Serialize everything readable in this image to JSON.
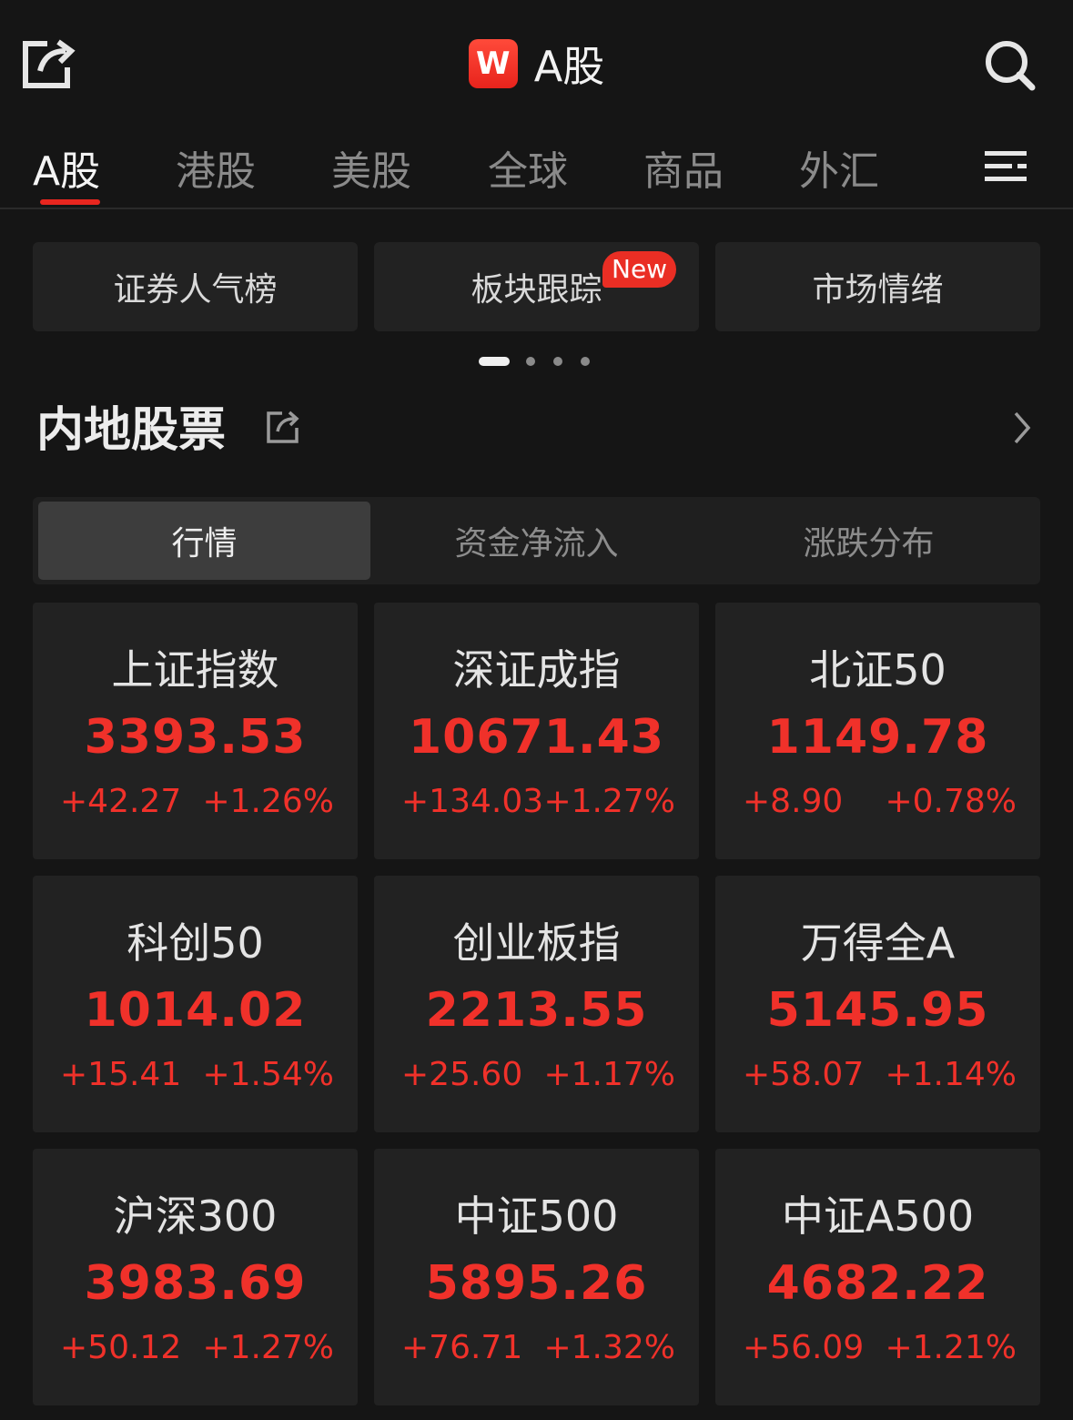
{
  "header": {
    "logo_letter": "W",
    "title": "A股",
    "icons": {
      "left": "share-icon",
      "right": "search-icon"
    }
  },
  "tabs": [
    {
      "label": "A股",
      "active": true
    },
    {
      "label": "港股"
    },
    {
      "label": "美股"
    },
    {
      "label": "全球"
    },
    {
      "label": "商品"
    },
    {
      "label": "外汇"
    }
  ],
  "quick_links": [
    {
      "label": "证券人气榜"
    },
    {
      "label": "板块跟踪",
      "badge": "New"
    },
    {
      "label": "市场情绪"
    }
  ],
  "section": {
    "title": "内地股票"
  },
  "segments": [
    {
      "label": "行情",
      "active": true
    },
    {
      "label": "资金净流入"
    },
    {
      "label": "涨跌分布"
    }
  ],
  "colors": {
    "up": "#f0312a",
    "accent": "#e8261f",
    "background": "#151515",
    "card": "#222222"
  },
  "indices": [
    {
      "name": "上证指数",
      "value": "3393.53",
      "change": "+42.27",
      "pct": "+1.26%"
    },
    {
      "name": "深证成指",
      "value": "10671.43",
      "change": "+134.03",
      "pct": "+1.27%"
    },
    {
      "name": "北证50",
      "value": "1149.78",
      "change": "+8.90",
      "pct": "+0.78%"
    },
    {
      "name": "科创50",
      "value": "1014.02",
      "change": "+15.41",
      "pct": "+1.54%"
    },
    {
      "name": "创业板指",
      "value": "2213.55",
      "change": "+25.60",
      "pct": "+1.17%"
    },
    {
      "name": "万得全A",
      "value": "5145.95",
      "change": "+58.07",
      "pct": "+1.14%"
    },
    {
      "name": "沪深300",
      "value": "3983.69",
      "change": "+50.12",
      "pct": "+1.27%"
    },
    {
      "name": "中证500",
      "value": "5895.26",
      "change": "+76.71",
      "pct": "+1.32%"
    },
    {
      "name": "中证A500",
      "value": "4682.22",
      "change": "+56.09",
      "pct": "+1.21%"
    }
  ]
}
